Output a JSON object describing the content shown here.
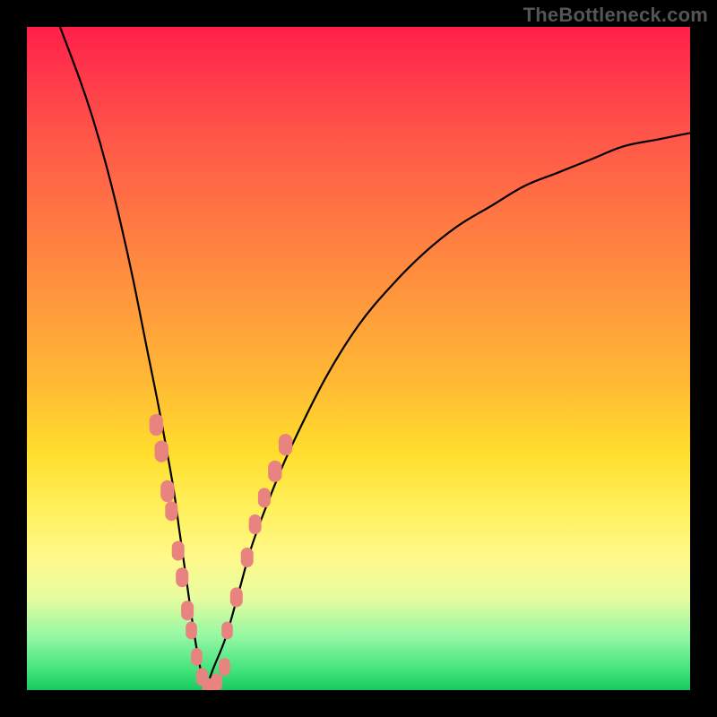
{
  "watermark": "TheBottleneck.com",
  "colors": {
    "background_frame": "#000000",
    "gradient_top": "#ff1f4a",
    "gradient_mid": "#ffdd2c",
    "gradient_bottom": "#18c95f",
    "curve": "#000000",
    "marker": "#e98380"
  },
  "chart_data": {
    "type": "line",
    "title": "",
    "xlabel": "",
    "ylabel": "",
    "xlim": [
      0,
      100
    ],
    "ylim": [
      0,
      100
    ],
    "note": "V-shaped bottleneck curve; values plunge to ~0 near x≈27 then rise. Data points estimated from pixel positions. Markers cluster on both branches near the minimum.",
    "series": [
      {
        "name": "left-branch",
        "x": [
          5,
          8,
          10,
          12,
          14,
          16,
          18,
          20,
          22,
          23,
          24,
          25,
          26,
          27
        ],
        "y": [
          100,
          92,
          86,
          79,
          71,
          62,
          52,
          42,
          31,
          24,
          17,
          10,
          4,
          0
        ]
      },
      {
        "name": "right-branch",
        "x": [
          27,
          28,
          30,
          32,
          34,
          37,
          40,
          45,
          50,
          55,
          60,
          65,
          70,
          75,
          80,
          85,
          90,
          95,
          100
        ],
        "y": [
          0,
          3,
          8,
          15,
          22,
          30,
          37,
          47,
          55,
          61,
          66,
          70,
          73,
          76,
          78,
          80,
          82,
          83,
          84
        ]
      }
    ],
    "markers": [
      {
        "x": 19.5,
        "y": 40,
        "r": 2.2
      },
      {
        "x": 20.3,
        "y": 36,
        "r": 2.2
      },
      {
        "x": 21.2,
        "y": 30,
        "r": 2.2
      },
      {
        "x": 21.8,
        "y": 27,
        "r": 2.0
      },
      {
        "x": 22.8,
        "y": 21,
        "r": 2.0
      },
      {
        "x": 23.4,
        "y": 17,
        "r": 2.0
      },
      {
        "x": 24.2,
        "y": 12,
        "r": 2.0
      },
      {
        "x": 24.8,
        "y": 9,
        "r": 1.8
      },
      {
        "x": 25.6,
        "y": 5,
        "r": 1.8
      },
      {
        "x": 26.4,
        "y": 2,
        "r": 1.8
      },
      {
        "x": 27.3,
        "y": 0.5,
        "r": 1.8
      },
      {
        "x": 28.6,
        "y": 1.2,
        "r": 1.8
      },
      {
        "x": 29.8,
        "y": 3.5,
        "r": 1.8
      },
      {
        "x": 30.2,
        "y": 9,
        "r": 1.8
      },
      {
        "x": 31.6,
        "y": 14,
        "r": 2.0
      },
      {
        "x": 33.2,
        "y": 20,
        "r": 2.0
      },
      {
        "x": 34.4,
        "y": 25,
        "r": 2.0
      },
      {
        "x": 35.8,
        "y": 29,
        "r": 2.0
      },
      {
        "x": 37.4,
        "y": 33,
        "r": 2.2
      },
      {
        "x": 39.0,
        "y": 37,
        "r": 2.2
      }
    ]
  }
}
